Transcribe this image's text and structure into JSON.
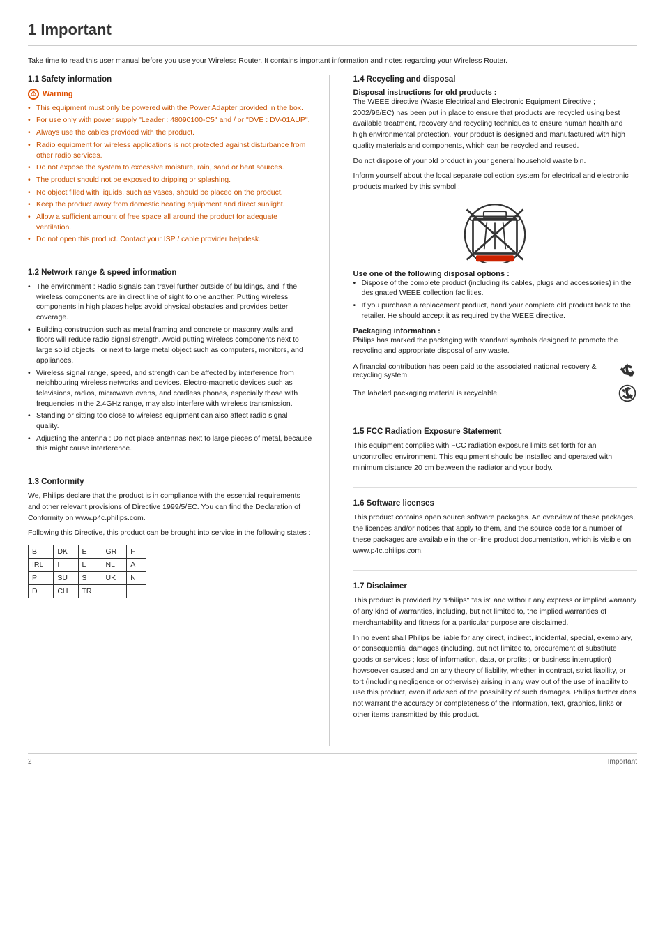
{
  "page": {
    "title": "1    Important",
    "footer_page": "2",
    "footer_label": "Important"
  },
  "intro": {
    "text": "Take time to read this user manual before you use your Wireless Router. It contains important information and notes regarding your Wireless Router."
  },
  "section1": {
    "title": "1.1   Safety information",
    "warning_label": "Warning",
    "warning_items": [
      "This equipment must only be powered with the Power Adapter provided in the box.",
      "For use only with power supply \"Leader : 48090100-C5\" and / or \"DVE : DV-01AUP\".",
      "Always use the cables provided with the product.",
      "Radio equipment for wireless applications is not protected against disturbance from other radio services.",
      "Do not expose the system to excessive moisture, rain, sand or heat sources.",
      "The product should not be exposed to dripping or splashing.",
      "No object filled with liquids, such as vases, should be placed on the product.",
      "Keep the product away from domestic heating equipment and direct sunlight.",
      "Allow a sufficient amount of free space all around the product for adequate ventilation.",
      "Do not open this product. Contact your ISP / cable provider helpdesk."
    ]
  },
  "section2": {
    "title": "1.2   Network range & speed information",
    "items": [
      "The environment : Radio signals can travel further outside of buildings, and if the wireless components are in direct line of sight to one another. Putting wireless components in high places helps avoid physical obstacles and provides better coverage.",
      "Building construction such as metal framing and concrete or masonry walls and floors will reduce radio signal strength. Avoid putting wireless components next to large solid objects ; or next to large metal object such as computers, monitors, and appliances.",
      "Wireless signal range, speed, and strength can be affected by interference from neighbouring wireless networks and devices. Electro-magnetic devices such as televisions, radios, microwave ovens, and cordless phones, especially those with frequencies in the 2.4GHz range, may also interfere with wireless transmission.",
      "Standing or sitting too close to wireless equipment can also affect radio signal quality.",
      "Adjusting the antenna : Do not place antennas next to large pieces of metal, because this might cause interference."
    ]
  },
  "section3": {
    "title": "1.3   Conformity",
    "para1": "We, Philips declare that the product is in compliance with the essential requirements and other relevant provisions of Directive 1999/5/EC. You can find the Declaration of Conformity on www.p4c.philips.com.",
    "para2": "Following this Directive, this product can be brought into service in the following states :",
    "countries": [
      [
        "B",
        "DK",
        "E",
        "GR",
        "F"
      ],
      [
        "IRL",
        "I",
        "L",
        "NL",
        "A"
      ],
      [
        "P",
        "SU",
        "S",
        "UK",
        "N"
      ],
      [
        "D",
        "CH",
        "TR",
        "",
        ""
      ]
    ]
  },
  "section4": {
    "title": "1.4   Recycling and disposal",
    "disposal_title": "Disposal instructions for old products :",
    "disposal_para": "The WEEE directive (Waste Electrical and Electronic Equipment Directive ; 2002/96/EC) has been put in place to ensure that products are recycled using best available treatment, recovery and recycling techniques to ensure human health and high environmental protection. Your product is designed and manufactured with high quality materials and components, which can be recycled and reused.",
    "disposal_para2": "Do not dispose of your old product in your general household waste bin.",
    "disposal_para3": "Inform yourself about the local separate collection system for electrical and electronic products marked by this symbol :",
    "use_one_title": "Use one of the following disposal options :",
    "use_one_items": [
      "Dispose of the complete product (including its cables, plugs and accessories) in the designated WEEE collection facilities.",
      "If you purchase a replacement product, hand your complete old product back to the retailer. He should accept it as required by the WEEE directive."
    ],
    "packaging_title": "Packaging information :",
    "packaging_para1": "Philips has marked the packaging with standard symbols designed to promote the recycling and appropriate disposal of any waste.",
    "packaging_para2": "A financial contribution has been paid to the associated national recovery & recycling system.",
    "packaging_para3": "The labeled packaging material is recyclable."
  },
  "section5": {
    "title": "1.5   FCC Radiation Exposure Statement",
    "para": "This equipment complies with FCC radiation exposure limits set forth for an uncontrolled environment. This equipment should be installed and operated with minimum distance 20 cm between the radiator and your body."
  },
  "section6": {
    "title": "1.6   Software licenses",
    "para": "This product contains open source software packages. An overview of these packages, the licences and/or notices that apply to them, and the source code for a number of these packages are available in the on-line product documentation, which is visible on www.p4c.philips.com."
  },
  "section7": {
    "title": "1.7   Disclaimer",
    "para1": "This product is provided by \"Philips\" \"as is\" and without any express or implied warranty of any kind of warranties, including, but not limited to, the implied warranties of merchantability and fitness for a particular purpose are disclaimed.",
    "para2": "In no event shall Philips be liable for any direct, indirect, incidental, special, exemplary, or consequential damages (including, but not limited to, procurement of substitute goods or services ; loss of information, data, or profits ; or business interruption) howsoever caused and on any theory of liability, whether in contract, strict liability, or tort (including negligence or otherwise) arising in any way out of the use of inability to use this product, even if advised of the possibility of such damages. Philips further does not warrant the accuracy or completeness of the information, text, graphics, links or other items transmitted by this product."
  }
}
